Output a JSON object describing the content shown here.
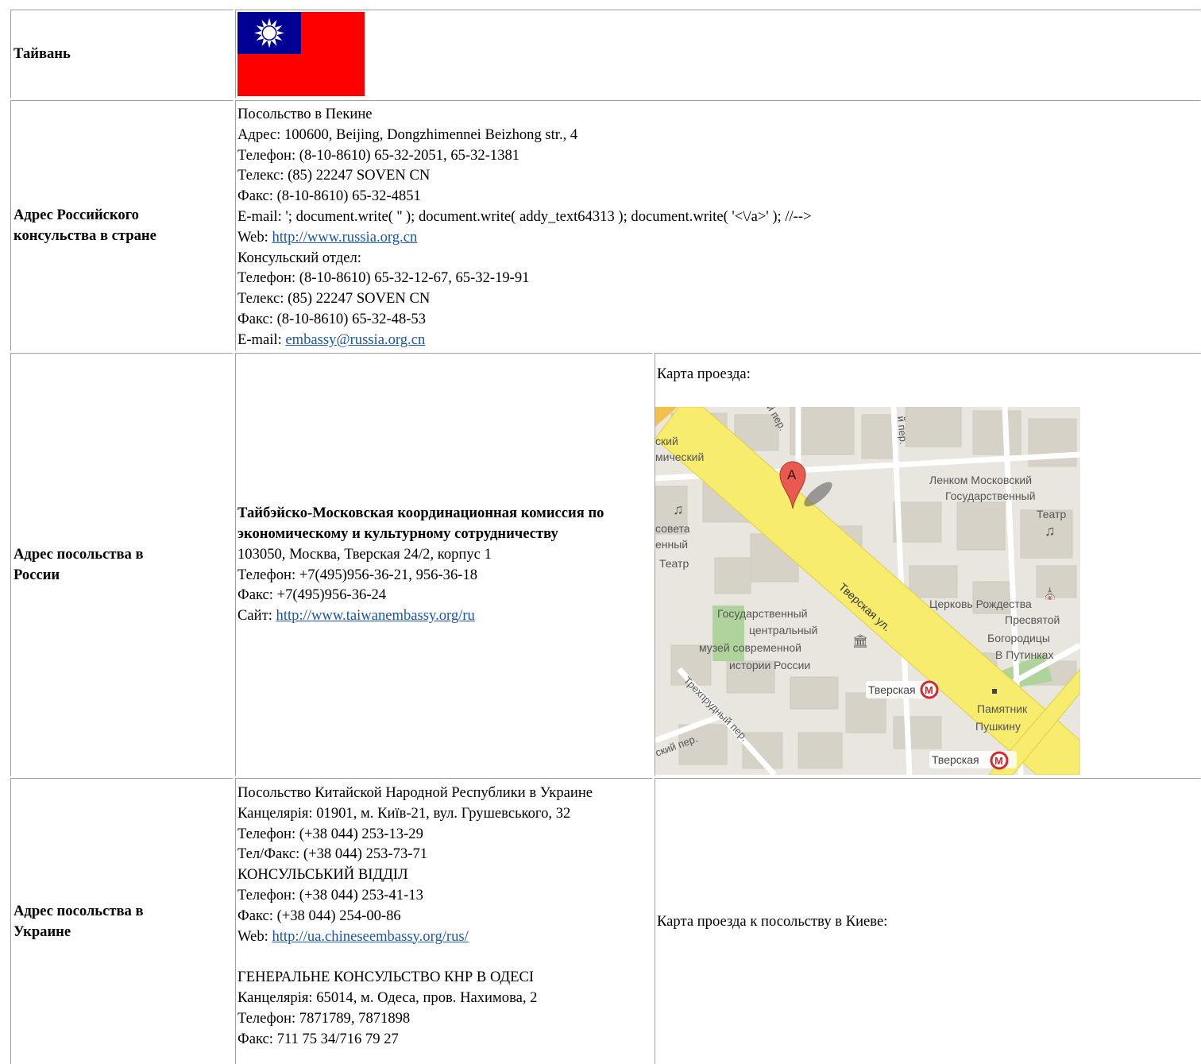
{
  "row_country": {
    "label": "Тайвань",
    "flag": {
      "name": "taiwan-flag",
      "colors": {
        "red": "#fe0000",
        "blue": "#000095",
        "sun": "#ffffff"
      }
    }
  },
  "row_consulate": {
    "label": "Адрес Российского консульства в стране",
    "lines": [
      "Посольство в Пекине",
      "Адрес: 100600, Beijing, Dongzhimennei Beizhong str., 4",
      "Телефон: (8-10-8610) 65-32-2051, 65-32-1381",
      "Телекс: (85) 22247 SOVEN CN",
      "Факс: (8-10-8610) 65-32-4851",
      "E-mail: '; document.write( '' ); document.write( addy_text64313 ); document.write( '<\\/a>' ); //-->"
    ],
    "web_label": "Web: ",
    "web_link": "http://www.russia.org.cn",
    "lines2": [
      "Консульский отдел:",
      "Телефон: (8-10-8610) 65-32-12-67, 65-32-19-91",
      "Телекс: (85) 22247 SOVEN CN",
      "Факс: (8-10-8610) 65-32-48-53"
    ],
    "email_label": "E-mail: ",
    "email_link": "embassy@russia.org.cn"
  },
  "row_russia": {
    "label": "Адрес посольства в России",
    "org_title": "Тайбэйско-Московская координационная комиссия по экономическому и культурному сотрудничеству",
    "lines": [
      "103050, Москва, Тверская 24/2, корпус 1",
      "Телефон:  +7(495)956-36-21, 956-36-18",
      "Факс: +7(495)956-36-24"
    ],
    "site_label": "Сайт: ",
    "site_link": "http://www.taiwanembassy.org/ru",
    "map_caption": "Карта проезда:",
    "map": {
      "street_labels": [
        "Тверская ул.",
        "Трехпрудный пер.",
        "ский пер.",
        "й пер."
      ],
      "place_labels": [
        "ский",
        "мический",
        "совета",
        "енный",
        "Театр",
        "Ленком Московский",
        "Государственный",
        "Театр",
        "Церковь Рождества",
        "Пресвятой",
        "Богородицы",
        "В Путинках",
        "Государственный",
        "центральный",
        "музей современной",
        "истории России",
        "Памятник",
        "Пушкину"
      ],
      "metro_labels": [
        "Тверская",
        "Тверская"
      ],
      "marker_letter": "A",
      "colors": {
        "road": "#f7ec6e",
        "block": "#d7d2c8",
        "bg": "#e9e6e0",
        "park": "#aed49c",
        "marker": "#e85a50"
      }
    }
  },
  "row_ukraine": {
    "label": "Адрес посольства в Украине",
    "lines": [
      "Посольство Китайской Народной Республики в Украине",
      "Канцелярія: 01901, м. Київ-21, вул. Грушевського, 32",
      "Телефон: (+38 044) 253-13-29",
      "Тел/Факс: (+38 044) 253-73-71",
      "КОНСУЛЬСЬКИЙ ВІДДІЛ",
      "Телефон: (+38 044) 253-41-13",
      "Факс: (+38 044) 254-00-86"
    ],
    "web_label": "Web: ",
    "web_link": "http://ua.chineseembassy.org/rus/",
    "lines2": [
      "ГЕНЕРАЛЬНЕ КОНСУЛЬСТВО КНР В ОДЕСІ",
      "Канцелярія: 65014, м. Одеса, пров. Нахимова, 2",
      "Телефон: 7871789, 7871898",
      "Факс: 711 75 34/716 79 27"
    ],
    "map_caption": "Карта проезда к посольству в Киеве:"
  }
}
